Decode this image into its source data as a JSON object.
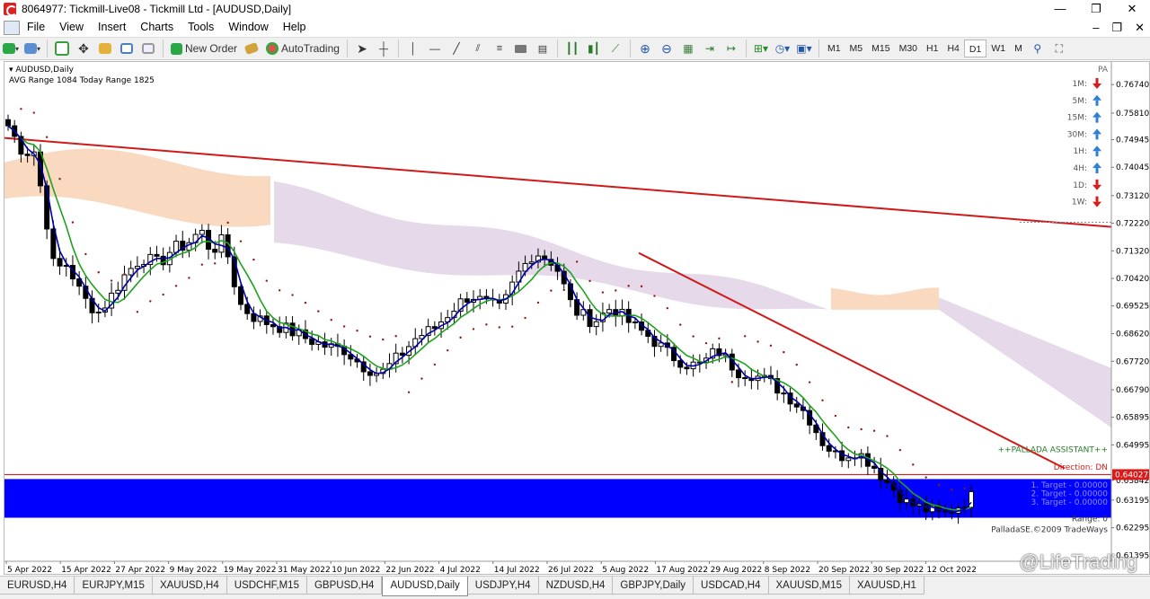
{
  "window": {
    "title": "8064977: Tickmill-Live08 - Tickmill Ltd - [AUDUSD,Daily]",
    "controls": [
      "—",
      "❐",
      "✕"
    ]
  },
  "menu": [
    "File",
    "View",
    "Insert",
    "Charts",
    "Tools",
    "Window",
    "Help"
  ],
  "doc_controls": [
    "–",
    "❐",
    "✕"
  ],
  "toolbar": {
    "new_order": "New Order",
    "autotrading": "AutoTrading",
    "timeframes": [
      "M1",
      "M5",
      "M15",
      "M30",
      "H1",
      "H4",
      "D1",
      "W1",
      "M"
    ],
    "active_timeframe": "D1"
  },
  "chart": {
    "symbol_label": "AUDUSD,Daily",
    "avg_range_text": "AVG Range 1084    Today Range 1825",
    "price_axis": [
      "0.76740",
      "0.75810",
      "0.74945",
      "0.74045",
      "0.73120",
      "0.72220",
      "0.71320",
      "0.70420",
      "0.69525",
      "0.68620",
      "0.67720",
      "0.66790",
      "0.65895",
      "0.64995",
      "0.63842",
      "0.63195",
      "0.62295",
      "0.61395"
    ],
    "current_price": "0.64027",
    "time_axis": [
      "5 Apr 2022",
      "15 Apr 2022",
      "27 Apr 2022",
      "9 May 2022",
      "19 May 2022",
      "31 May 2022",
      "10 Jun 2022",
      "22 Jun 2022",
      "4 Jul 2022",
      "14 Jul 2022",
      "26 Jul 2022",
      "5 Aug 2022",
      "17 Aug 2022",
      "29 Aug 2022",
      "8 Sep 2022",
      "20 Sep 2022",
      "30 Sep 2022",
      "12 Oct 2022"
    ],
    "pa_label": "PA",
    "pa_panel": [
      {
        "tf": "1M:",
        "dir": "down"
      },
      {
        "tf": "5M:",
        "dir": "up"
      },
      {
        "tf": "15M:",
        "dir": "up"
      },
      {
        "tf": "30M:",
        "dir": "up"
      },
      {
        "tf": "1H:",
        "dir": "up"
      },
      {
        "tf": "4H:",
        "dir": "up"
      },
      {
        "tf": "1D:",
        "dir": "down"
      },
      {
        "tf": "1W:",
        "dir": "down"
      }
    ],
    "assistant": {
      "header": "++PALLADA ASSISTANT++",
      "direction": "Direction: DN",
      "targets": [
        "1. Target - 0.00000",
        "2. Target - 0.00000",
        "3. Target - 0.00000"
      ],
      "range": "Range: 0",
      "copyright": "PalladaSE.©2009 TradeWays"
    },
    "colors": {
      "up_arrow": "#2f7fd6",
      "down_arrow": "#d81b1b",
      "trendline": "#d01a1a",
      "zone": "#0000ff",
      "cloud_bull": "#f9d9c0",
      "cloud_bear": "#e5d9ea",
      "ma_fast": "#0000a8",
      "ma_slow": "#1fa31f",
      "sar_dots": "#8b1a1a"
    }
  },
  "tabs": [
    "EURUSD,H4",
    "EURJPY,M15",
    "XAUUSD,H4",
    "USDCHF,M15",
    "GBPUSD,H4",
    "AUDUSD,Daily",
    "USDJPY,H4",
    "NZDUSD,H4",
    "GBPJPY,Daily",
    "USDCAD,H4",
    "XAUUSD,M15",
    "XAUUSD,H1"
  ],
  "active_tab": "AUDUSD,Daily",
  "watermark": "@LifeTrading"
}
